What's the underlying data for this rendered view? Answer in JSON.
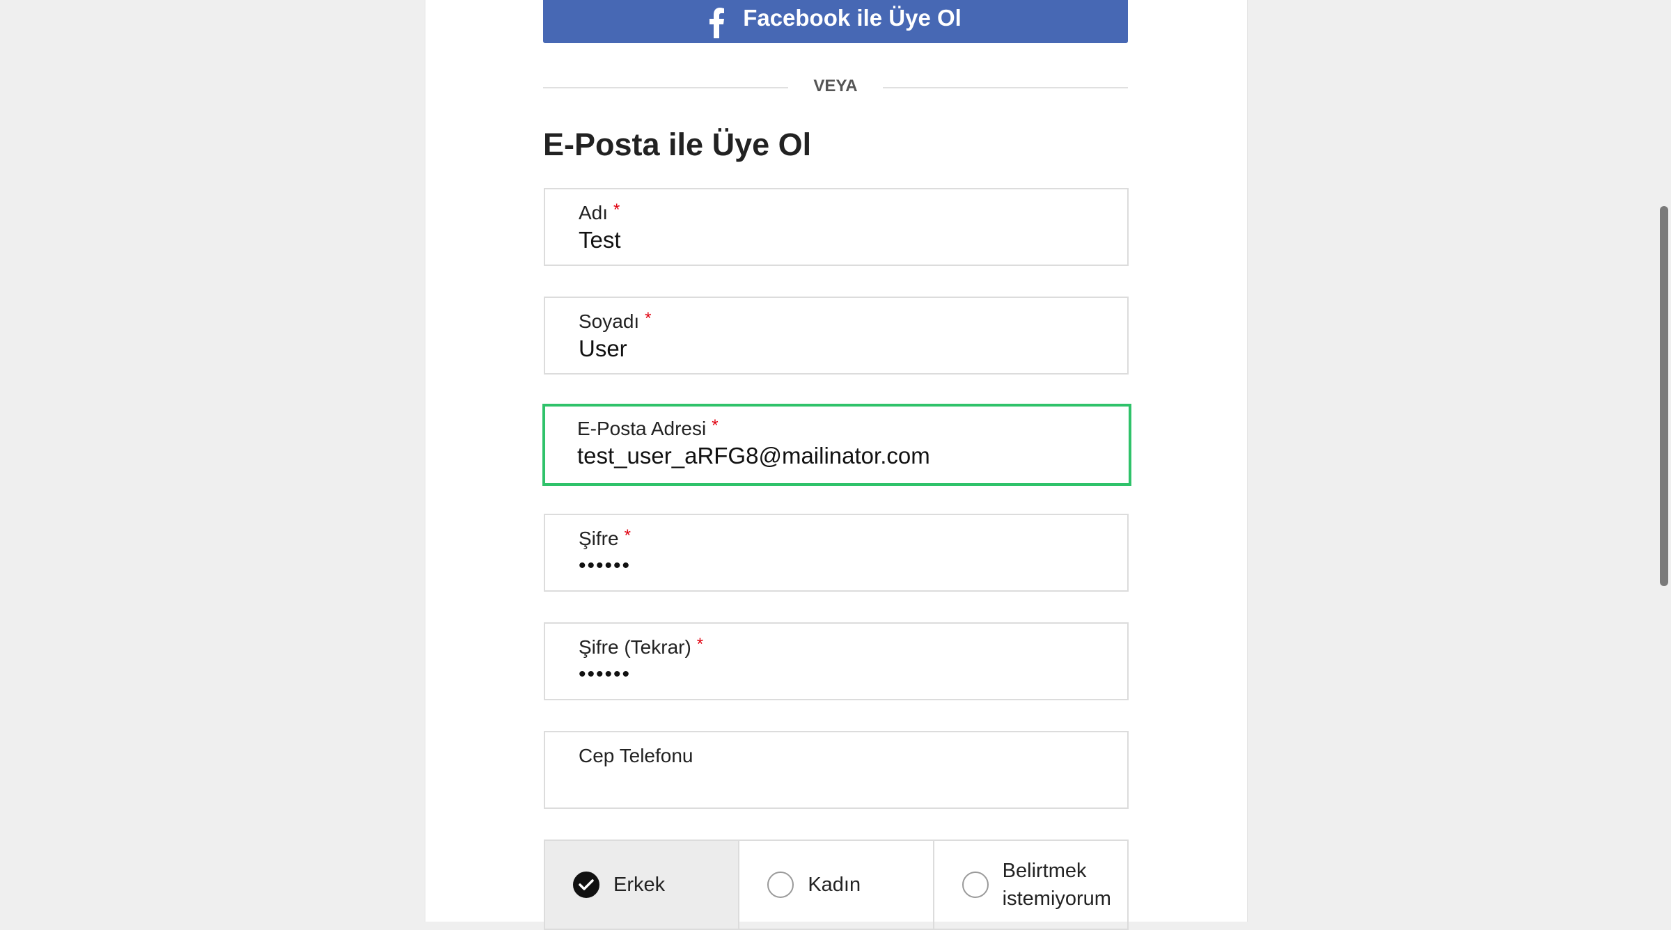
{
  "facebook_button": {
    "label": "Facebook ile Üye Ol",
    "color": "#4768b4",
    "icon": "facebook-icon"
  },
  "divider": {
    "text": "VEYA"
  },
  "form": {
    "title": "E-Posta ile Üye Ol",
    "required_marker": "*",
    "fields": {
      "first_name": {
        "label": "Adı",
        "value": "Test",
        "required": true
      },
      "last_name": {
        "label": "Soyadı",
        "value": "User",
        "required": true
      },
      "email": {
        "label": "E-Posta Adresi",
        "value": "test_user_aRFG8@mailinator.com",
        "required": true,
        "focused": true
      },
      "password": {
        "label": "Şifre",
        "value": "••••••",
        "required": true
      },
      "password_confirm": {
        "label": "Şifre (Tekrar)",
        "value": "••••••",
        "required": true
      },
      "phone": {
        "label": "Cep Telefonu",
        "value": "",
        "required": false
      }
    },
    "gender": {
      "options": [
        {
          "label": "Erkek",
          "selected": true
        },
        {
          "label": "Kadın",
          "selected": false
        },
        {
          "label": "Belirtmek istemiyorum",
          "selected": false
        }
      ]
    }
  },
  "colors": {
    "focus_border": "#2fc26a",
    "required": "#e0000f",
    "background": "#efefef"
  }
}
